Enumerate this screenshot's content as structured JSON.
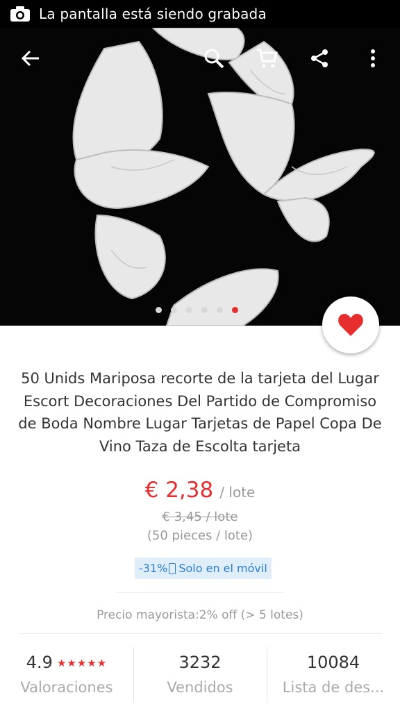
{
  "status_bar": {
    "text": "La pantalla está siendo grabada"
  },
  "toolbar": {
    "icons": [
      "back-icon",
      "search-icon",
      "cart-icon",
      "share-icon",
      "more-icon"
    ]
  },
  "gallery": {
    "image_count": 6,
    "active_index": 5
  },
  "product": {
    "title": "50 Unids Mariposa recorte de la tarjeta del Lugar Escort Decoraciones Del Partido de Compromiso de Boda Nombre Lugar Tarjetas de Papel Copa De Vino Taza de Escolta tarjeta",
    "price": "€ 2,38",
    "price_unit": "/ lote",
    "old_price": "€ 3,45 / lote",
    "pieces": "(50 pieces / lote)",
    "promo_discount": "-31%",
    "promo_text": "Solo en el móvil",
    "wholesale": "Precio mayorista:2% off (> 5 lotes)"
  },
  "stats": {
    "rating_value": "4.9",
    "rating_stars": "★★★★★",
    "rating_label": "Valoraciones",
    "sold_value": "3232",
    "sold_label": "Vendidos",
    "wishlist_value": "10084",
    "wishlist_label": "Lista de des..."
  },
  "colors": {
    "accent": "#e62e2e",
    "promo_bg": "#dfeef9",
    "promo_text": "#2a7bd0"
  }
}
